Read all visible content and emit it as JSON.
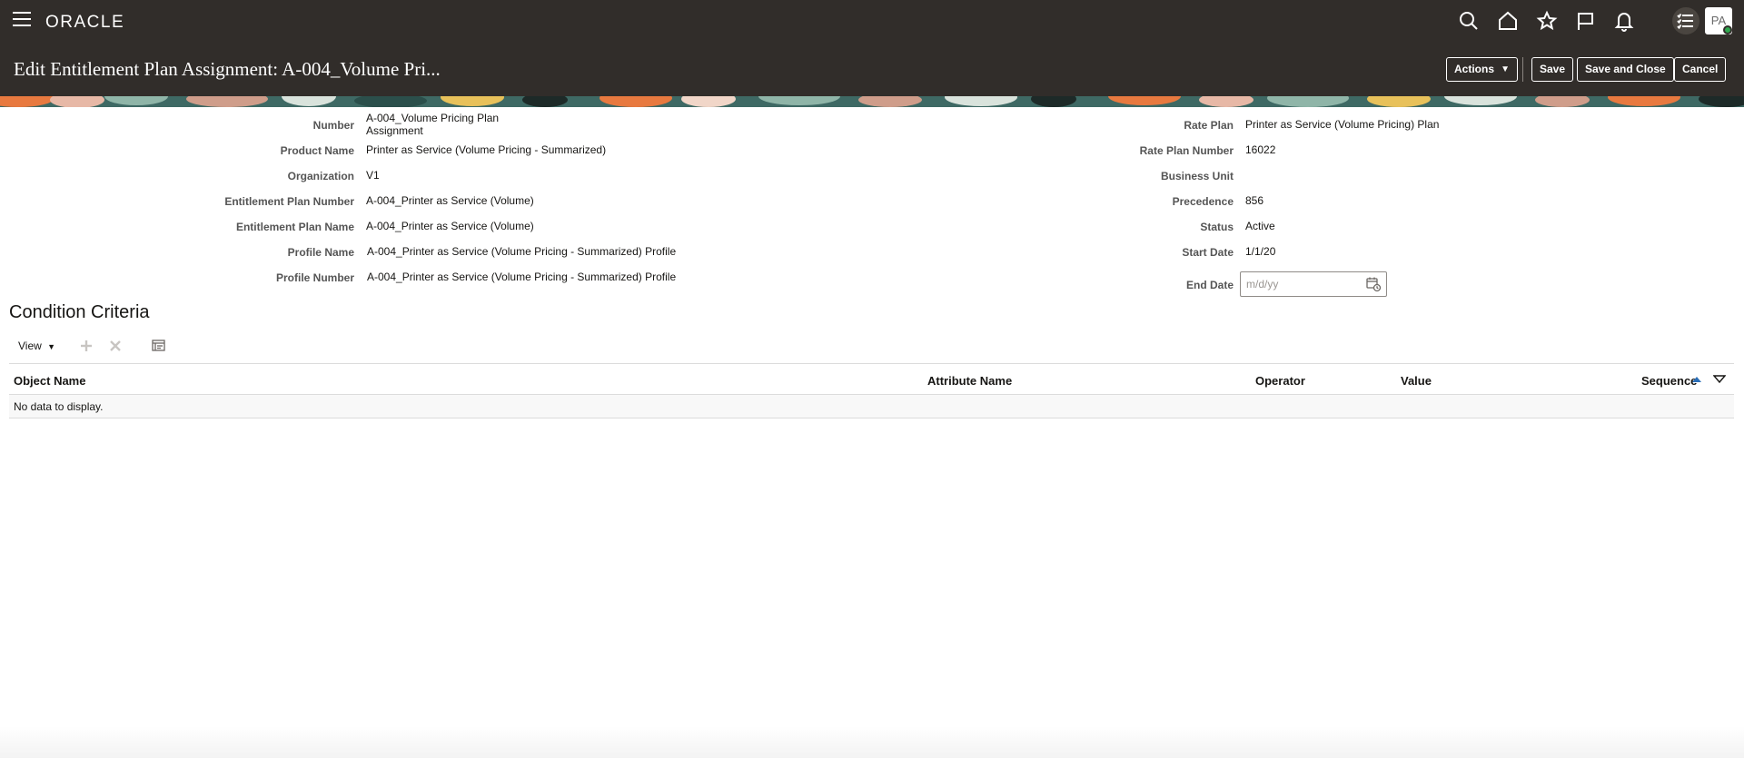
{
  "app": {
    "logo": "ORACLE",
    "avatar_initials": "PA"
  },
  "header": {
    "title": "Edit Entitlement Plan Assignment: A-004_Volume Pri...",
    "actions_label": "Actions",
    "save_label": "Save",
    "save_close_label": "Save and Close",
    "cancel_label": "Cancel"
  },
  "form": {
    "left": [
      {
        "label": "Number",
        "value": "A-004_Volume Pricing Plan\nAssignment"
      },
      {
        "label": "Product Name",
        "value": "Printer as Service (Volume Pricing - Summarized)"
      },
      {
        "label": "Organization",
        "value": "V1"
      },
      {
        "label": "Entitlement Plan Number",
        "value": "A-004_Printer as Service (Volume)"
      },
      {
        "label": "Entitlement Plan Name",
        "value": "A-004_Printer as Service (Volume)"
      },
      {
        "label": "Profile Name",
        "value": "A-004_Printer as Service (Volume Pricing - Summarized) Profile"
      },
      {
        "label": "Profile Number",
        "value": "A-004_Printer as Service (Volume Pricing - Summarized) Profile"
      }
    ],
    "right": [
      {
        "label": "Rate Plan",
        "value": "Printer as Service (Volume Pricing) Plan"
      },
      {
        "label": "Rate Plan Number",
        "value": "16022"
      },
      {
        "label": "Business Unit",
        "value": ""
      },
      {
        "label": "Precedence",
        "value": "856"
      },
      {
        "label": "Status",
        "value": "Active"
      },
      {
        "label": "Start Date",
        "value": "1/1/20"
      }
    ],
    "end_date": {
      "label": "End Date",
      "placeholder": "m/d/yy",
      "value": ""
    }
  },
  "condition_criteria": {
    "title": "Condition Criteria",
    "view_label": "View",
    "columns": [
      "Object Name",
      "Attribute Name",
      "Operator",
      "Value",
      "Sequence"
    ],
    "empty_text": "No data to display."
  },
  "colors": {
    "header_bg": "#312d2a",
    "banner_teal": "#3e6964",
    "banner_orange": "#e8793f",
    "banner_pink": "#e7b8a6",
    "banner_yellow": "#e8c15a"
  },
  "icons": [
    "menu-icon",
    "search-icon",
    "home-icon",
    "star-icon",
    "flag-icon",
    "bell-icon",
    "task-list-icon",
    "calendar-icon",
    "add-icon",
    "delete-icon",
    "freeze-icon",
    "sort-icon",
    "column-menu-icon"
  ]
}
